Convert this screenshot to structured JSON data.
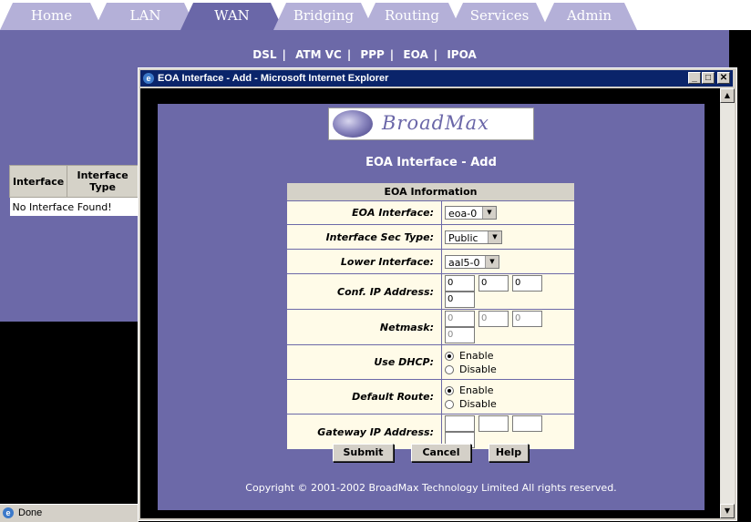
{
  "tabs": [
    {
      "label": "Home"
    },
    {
      "label": "LAN"
    },
    {
      "label": "WAN"
    },
    {
      "label": "Bridging"
    },
    {
      "label": "Routing"
    },
    {
      "label": "Services"
    },
    {
      "label": "Admin"
    }
  ],
  "subnav": [
    "DSL",
    "ATM VC",
    "PPP",
    "EOA",
    "IPOA"
  ],
  "parent_table": {
    "headers": [
      "Interface",
      "Interface Type"
    ],
    "empty_message": "No Interface Found!"
  },
  "statusbar": {
    "text": "Done"
  },
  "popup": {
    "title": "EOA Interface - Add - Microsoft Internet Explorer",
    "logo_text": "BroadMax",
    "page_title": "EOA Interface - Add",
    "section_header": "EOA Information",
    "fields": {
      "eoa_interface": {
        "label": "EOA Interface:",
        "value": "eoa-0"
      },
      "sec_type": {
        "label": "Interface Sec Type:",
        "value": "Public"
      },
      "lower_interface": {
        "label": "Lower Interface:",
        "value": "aal5-0"
      },
      "conf_ip": {
        "label": "Conf. IP Address:",
        "octets": [
          "0",
          "0",
          "0",
          "0"
        ]
      },
      "netmask": {
        "label": "Netmask:",
        "octets": [
          "0",
          "0",
          "0",
          "0"
        ]
      },
      "use_dhcp": {
        "label": "Use DHCP:",
        "options": [
          "Enable",
          "Disable"
        ],
        "selected": "Enable"
      },
      "default_route": {
        "label": "Default Route:",
        "options": [
          "Enable",
          "Disable"
        ],
        "selected": "Enable"
      },
      "gateway_ip": {
        "label": "Gateway IP Address:",
        "octets": [
          "",
          "",
          "",
          ""
        ]
      }
    },
    "buttons": {
      "submit": "Submit",
      "cancel": "Cancel",
      "help": "Help"
    },
    "copyright": "Copyright © 2001-2002 BroadMax Technology Limited All rights reserved."
  },
  "colors": {
    "accent": "#6c69a8",
    "tab": "#b4b0d8",
    "titlebar": "#0a246a"
  }
}
